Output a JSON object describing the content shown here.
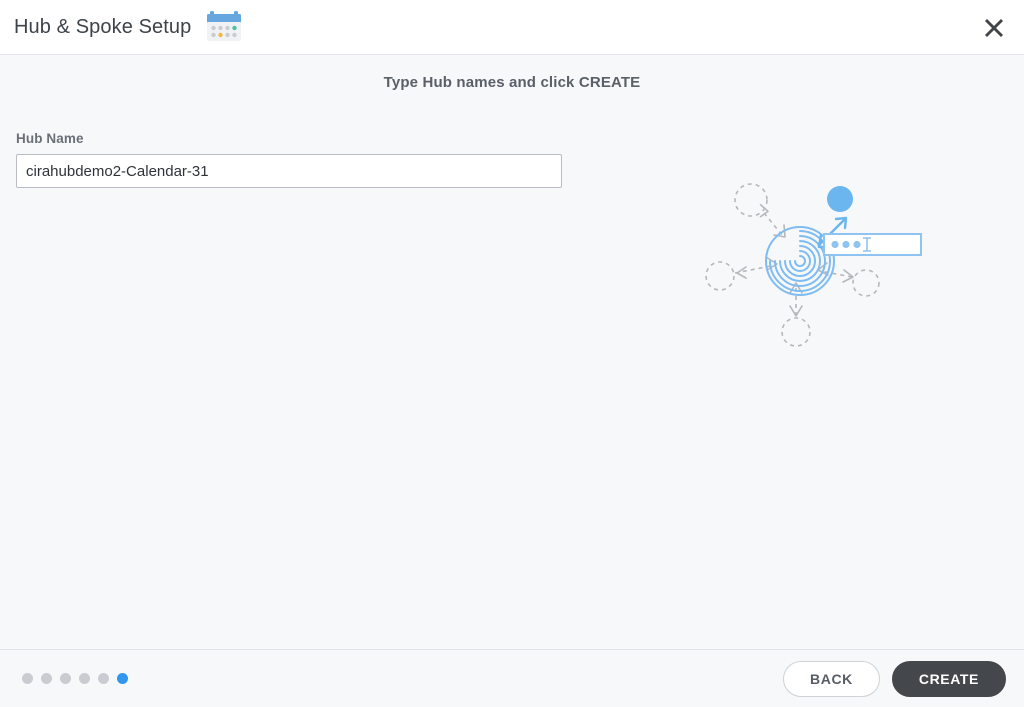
{
  "header": {
    "title": "Hub & Spoke Setup",
    "icon": "calendar-icon",
    "close_icon": "close-icon"
  },
  "main": {
    "step_heading": "Type Hub names and click CREATE",
    "field_label": "Hub Name",
    "hub_name_value": "cirahubdemo2-Calendar-31",
    "hub_name_placeholder": "",
    "illustration": {
      "name": "hub-and-spoke-diagram",
      "hub_icon": "spiral-hub-icon",
      "highlighted_node": "active-spoke-node",
      "input_preview": "hub-name-input-preview",
      "input_preview_dots": "● ● ●",
      "spoke_count": 5
    }
  },
  "footer": {
    "steps_total": 6,
    "current_step": 6,
    "back_label": "BACK",
    "create_label": "CREATE"
  },
  "colors": {
    "accent_blue": "#2f97f0",
    "node_blue": "#6cb6f0",
    "hub_blue": "#7fbcf2",
    "spoke_gray": "#b6b8bb",
    "create_dark": "#44474b",
    "page_bg": "#f7f8fa",
    "calendar_green": "#4ec2a0",
    "calendar_amber": "#f0b942",
    "calendar_blue": "#66a7e0"
  }
}
